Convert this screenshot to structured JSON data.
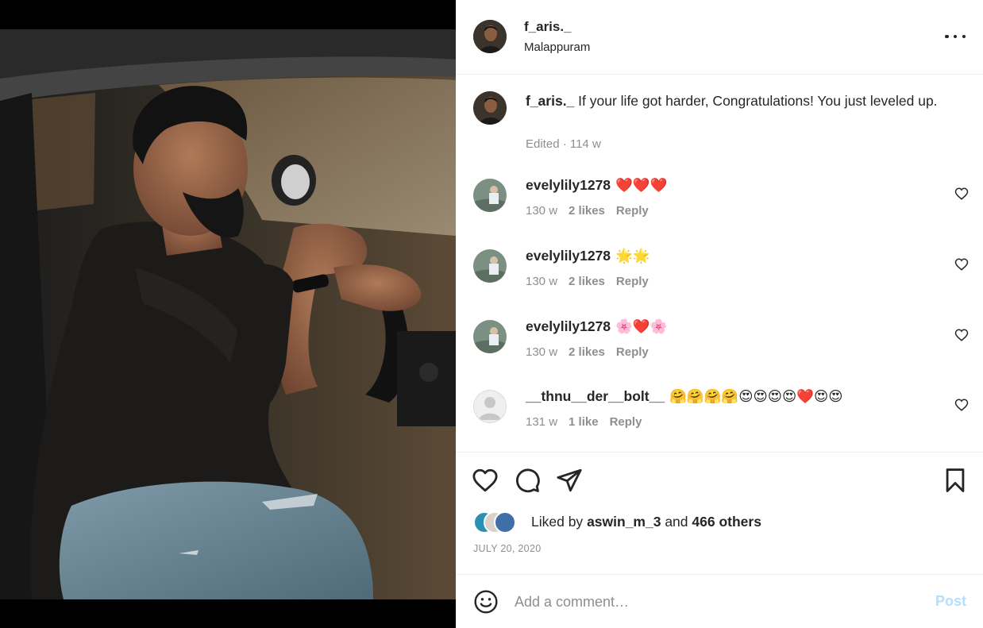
{
  "post": {
    "author": "f_aris._",
    "location": "Malappuram",
    "caption": "If your life got harder, Congratulations! You just leveled up.",
    "caption_meta": "Edited · 114 w",
    "more_icon": "more-horizontal-icon"
  },
  "comments": [
    {
      "user": "evelylily1278",
      "text": "❤️❤️❤️",
      "age": "130 w",
      "likes": "2 likes",
      "reply": "Reply"
    },
    {
      "user": "evelylily1278",
      "text": "🌟🌟",
      "age": "130 w",
      "likes": "2 likes",
      "reply": "Reply"
    },
    {
      "user": "evelylily1278",
      "text": "🌸❤️🌸",
      "age": "130 w",
      "likes": "2 likes",
      "reply": "Reply"
    },
    {
      "user": "__thnu__der__bolt__",
      "text": "🤗🤗🤗🤗😍😍😍😍❤️😍😍",
      "age": "131 w",
      "likes": "1 like",
      "reply": "Reply"
    }
  ],
  "actions": {
    "like_icon": "heart-icon",
    "comment_icon": "comment-icon",
    "share_icon": "send-icon",
    "save_icon": "bookmark-icon"
  },
  "likes": {
    "prefix": "Liked by",
    "user": "aswin_m_3",
    "and": "and",
    "others": "466 others"
  },
  "date": "JULY 20, 2020",
  "comment_box": {
    "placeholder": "Add a comment…",
    "post_label": "Post",
    "emoji_icon": "smiley-icon"
  },
  "colors": {
    "primary_text": "#262626",
    "secondary_text": "#8e8e8e",
    "heart_red": "#ed4956",
    "post_button_disabled": "#b2dffc"
  }
}
